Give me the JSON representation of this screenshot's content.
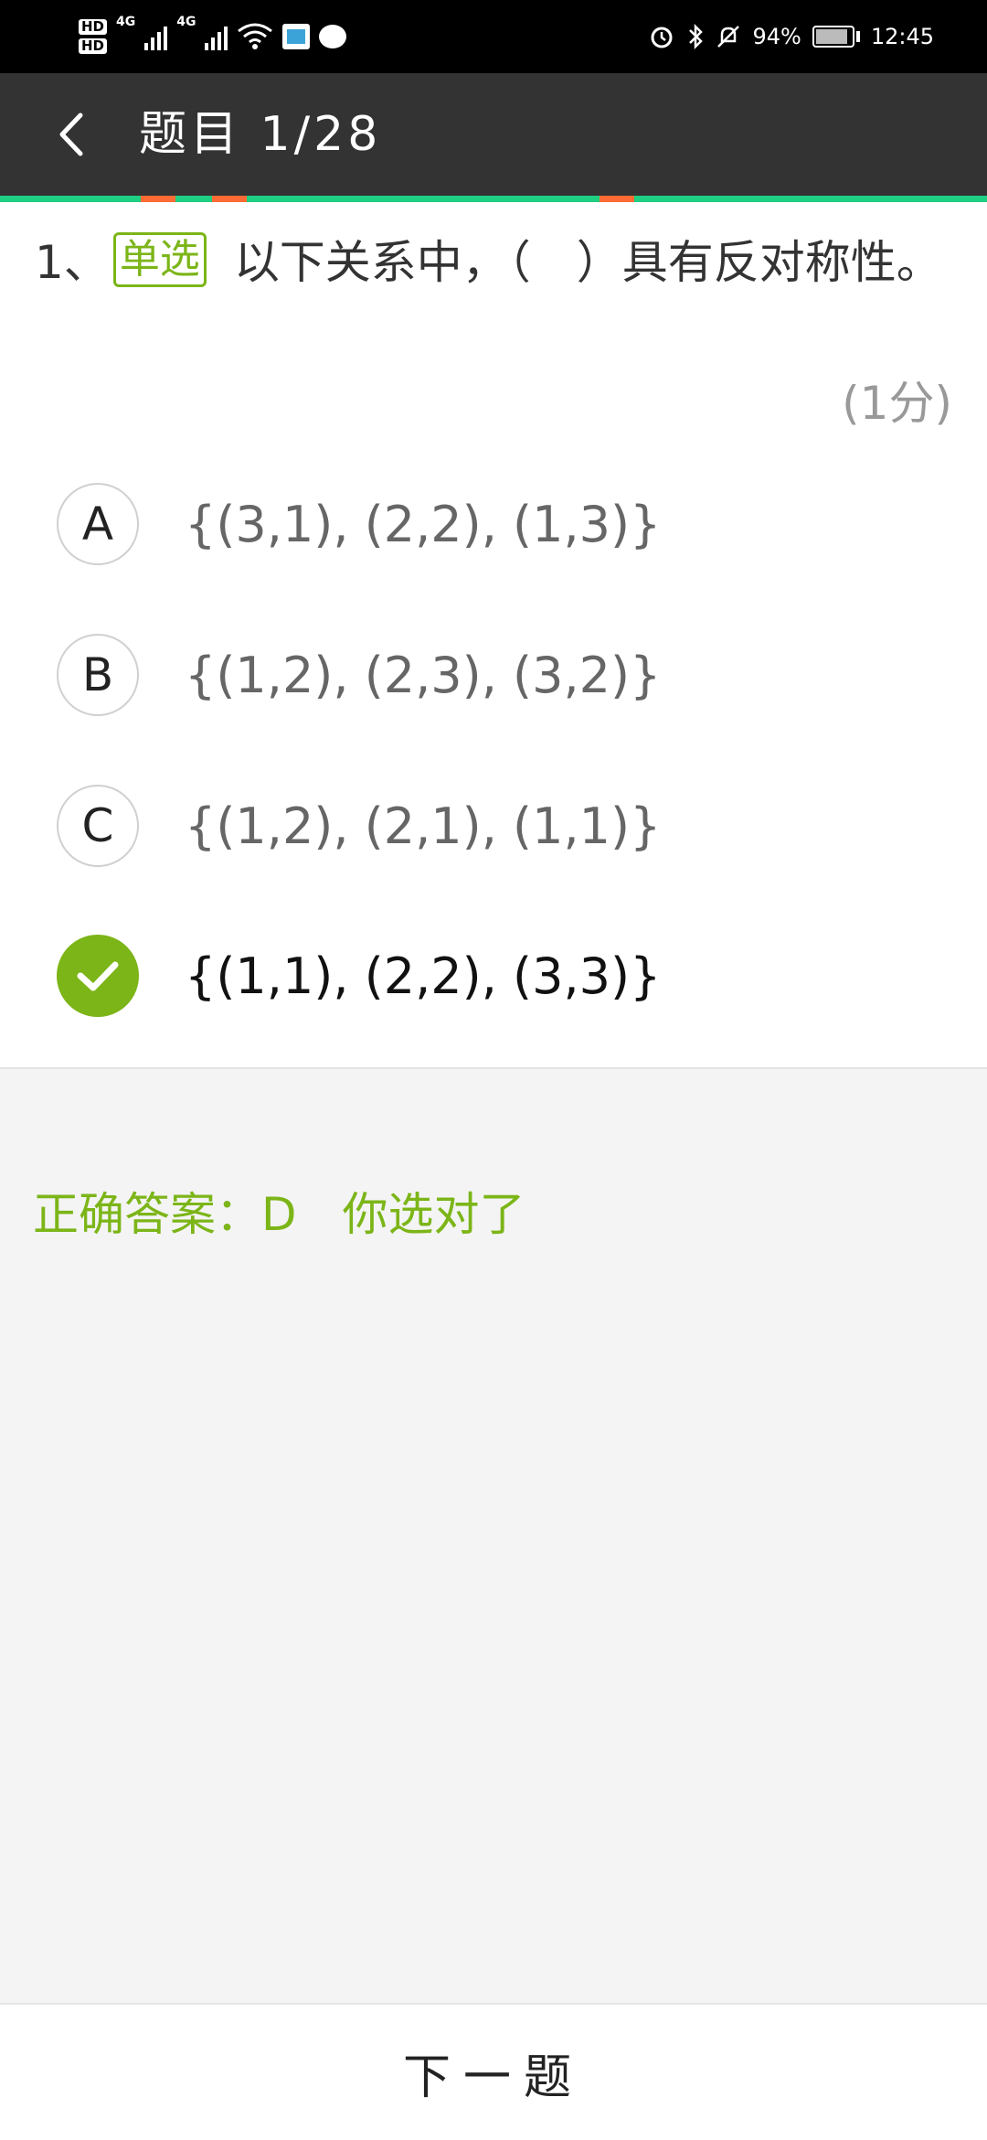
{
  "status_bar": {
    "hd1": "HD",
    "hd2": "HD",
    "network1": "4G",
    "network2": "4G",
    "battery": "94%",
    "time": "12:45"
  },
  "header": {
    "title": "题目 1/28"
  },
  "question": {
    "number": "1、",
    "type_tag": "单选",
    "text": "以下关系中，（　）具有反对称性。",
    "score": "(1分)"
  },
  "options": [
    {
      "letter": "A",
      "text": "{(3,1), (2,2), (1,3)}",
      "selected": false
    },
    {
      "letter": "B",
      "text": "{(1,2), (2,3), (3,2)}",
      "selected": false
    },
    {
      "letter": "C",
      "text": "{(1,2), (2,1), (1,1)}",
      "selected": false
    },
    {
      "letter": "D",
      "text": "{(1,1), (2,2), (3,3)}",
      "selected": true
    }
  ],
  "answer": {
    "text": "正确答案：D　你选对了"
  },
  "footer": {
    "next_label": "下一题"
  },
  "colors": {
    "accent_green": "#7cb518",
    "progress_green": "#1fcf83",
    "progress_mark": "#ff6b35",
    "header_bg": "#333333"
  },
  "icons": {
    "back": "chevron-left-icon",
    "selected": "check-icon"
  }
}
